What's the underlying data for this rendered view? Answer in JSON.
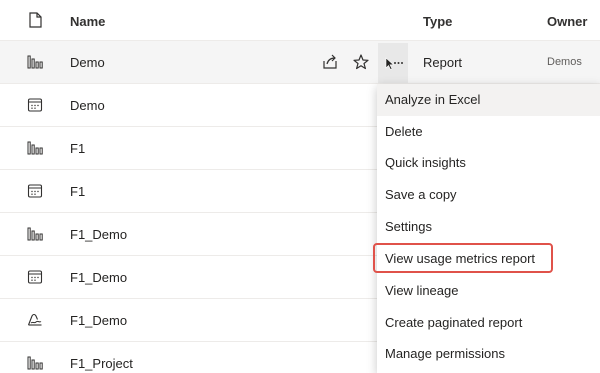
{
  "header": {
    "name": "Name",
    "type": "Type",
    "owner": "Owner"
  },
  "rows": [
    {
      "name": "Demo",
      "icon": "bar-chart-icon",
      "type": "Report",
      "owner": "Demos"
    },
    {
      "name": "Demo",
      "icon": "dashboard-icon"
    },
    {
      "name": "F1",
      "icon": "bar-chart-icon"
    },
    {
      "name": "F1",
      "icon": "dashboard-icon"
    },
    {
      "name": "F1_Demo",
      "icon": "bar-chart-icon"
    },
    {
      "name": "F1_Demo",
      "icon": "dashboard-icon"
    },
    {
      "name": "F1_Demo",
      "icon": "dataset-icon"
    },
    {
      "name": "F1_Project",
      "icon": "bar-chart-icon"
    }
  ],
  "context_menu": {
    "items": [
      "Analyze in Excel",
      "Delete",
      "Quick insights",
      "Save a copy",
      "Settings",
      "View usage metrics report",
      "View lineage",
      "Create paginated report",
      "Manage permissions"
    ],
    "highlighted_item": "View usage metrics report"
  },
  "colors": {
    "highlight_border": "#e0524a",
    "row_divider": "#edebe9",
    "more_button_bg": "#e8e8e8"
  }
}
